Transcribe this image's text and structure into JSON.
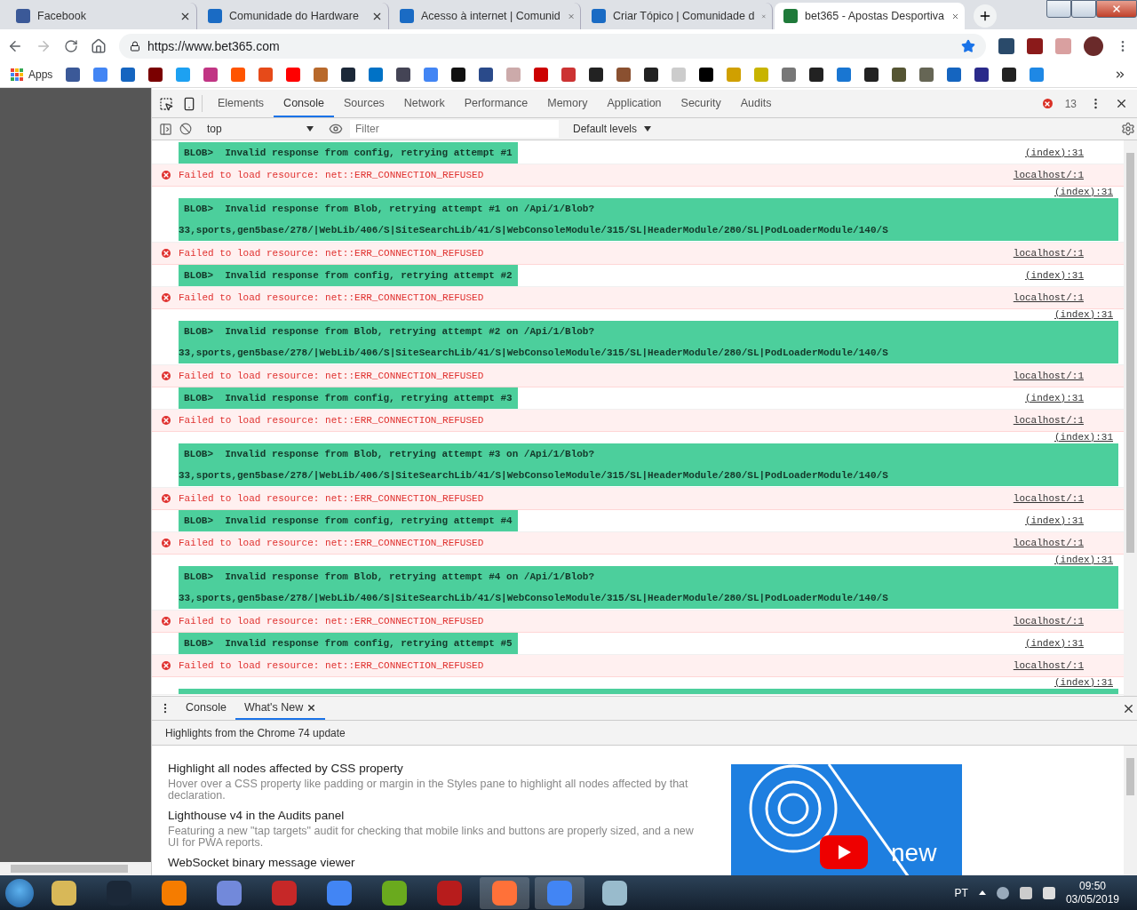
{
  "browser": {
    "tabs": [
      {
        "title": "Facebook",
        "selected": false
      },
      {
        "title": "Comunidade do Hardware",
        "selected": false
      },
      {
        "title": "Acesso à internet | Comunid",
        "selected": false
      },
      {
        "title": "Criar Tópico | Comunidade d",
        "selected": false
      },
      {
        "title": "bet365 - Apostas Desportiva",
        "selected": true
      }
    ],
    "url": "https://www.bet365.com",
    "bookmarks_label": "Apps"
  },
  "devtools": {
    "tabs": [
      {
        "label": "Elements",
        "selected": false
      },
      {
        "label": "Console",
        "selected": true
      },
      {
        "label": "Sources",
        "selected": false
      },
      {
        "label": "Network",
        "selected": false
      },
      {
        "label": "Performance",
        "selected": false
      },
      {
        "label": "Memory",
        "selected": false
      },
      {
        "label": "Application",
        "selected": false
      },
      {
        "label": "Security",
        "selected": false
      },
      {
        "label": "Audits",
        "selected": false
      }
    ],
    "error_count": "13",
    "console_toolbar": {
      "context": "top",
      "filter_placeholder": "Filter",
      "levels": "Default levels"
    },
    "messages": [
      {
        "kind": "blob",
        "lines": [
          "BLOB>  Invalid response from config, retrying attempt #1"
        ],
        "source": "(index):31"
      },
      {
        "kind": "error",
        "lines": [
          "Failed to load resource: net::ERR_CONNECTION_REFUSED"
        ],
        "source": "localhost/:1"
      },
      {
        "kind": "blob_long",
        "lines": [
          "BLOB>  Invalid response from Blob, retrying attempt #1 on /Api/1/Blob?",
          "33,sports,gen5base/278/|WebLib/406/S|SiteSearchLib/41/S|WebConsoleModule/315/SL|HeaderModule/280/SL|PodLoaderModule/140/S"
        ],
        "source": "(index):31"
      },
      {
        "kind": "error",
        "lines": [
          "Failed to load resource: net::ERR_CONNECTION_REFUSED"
        ],
        "source": "localhost/:1"
      },
      {
        "kind": "blob",
        "lines": [
          "BLOB>  Invalid response from config, retrying attempt #2"
        ],
        "source": "(index):31"
      },
      {
        "kind": "error",
        "lines": [
          "Failed to load resource: net::ERR_CONNECTION_REFUSED"
        ],
        "source": "localhost/:1"
      },
      {
        "kind": "blob_long",
        "lines": [
          "BLOB>  Invalid response from Blob, retrying attempt #2 on /Api/1/Blob?",
          "33,sports,gen5base/278/|WebLib/406/S|SiteSearchLib/41/S|WebConsoleModule/315/SL|HeaderModule/280/SL|PodLoaderModule/140/S"
        ],
        "source": "(index):31"
      },
      {
        "kind": "error",
        "lines": [
          "Failed to load resource: net::ERR_CONNECTION_REFUSED"
        ],
        "source": "localhost/:1"
      },
      {
        "kind": "blob",
        "lines": [
          "BLOB>  Invalid response from config, retrying attempt #3"
        ],
        "source": "(index):31"
      },
      {
        "kind": "error",
        "lines": [
          "Failed to load resource: net::ERR_CONNECTION_REFUSED"
        ],
        "source": "localhost/:1"
      },
      {
        "kind": "blob_long",
        "lines": [
          "BLOB>  Invalid response from Blob, retrying attempt #3 on /Api/1/Blob?",
          "33,sports,gen5base/278/|WebLib/406/S|SiteSearchLib/41/S|WebConsoleModule/315/SL|HeaderModule/280/SL|PodLoaderModule/140/S"
        ],
        "source": "(index):31"
      },
      {
        "kind": "error",
        "lines": [
          "Failed to load resource: net::ERR_CONNECTION_REFUSED"
        ],
        "source": "localhost/:1"
      },
      {
        "kind": "blob",
        "lines": [
          "BLOB>  Invalid response from config, retrying attempt #4"
        ],
        "source": "(index):31"
      },
      {
        "kind": "error",
        "lines": [
          "Failed to load resource: net::ERR_CONNECTION_REFUSED"
        ],
        "source": "localhost/:1"
      },
      {
        "kind": "blob_long",
        "lines": [
          "BLOB>  Invalid response from Blob, retrying attempt #4 on /Api/1/Blob?",
          "33,sports,gen5base/278/|WebLib/406/S|SiteSearchLib/41/S|WebConsoleModule/315/SL|HeaderModule/280/SL|PodLoaderModule/140/S"
        ],
        "source": "(index):31"
      },
      {
        "kind": "error",
        "lines": [
          "Failed to load resource: net::ERR_CONNECTION_REFUSED"
        ],
        "source": "localhost/:1"
      },
      {
        "kind": "blob",
        "lines": [
          "BLOB>  Invalid response from config, retrying attempt #5"
        ],
        "source": "(index):31"
      },
      {
        "kind": "error",
        "lines": [
          "Failed to load resource: net::ERR_CONNECTION_REFUSED"
        ],
        "source": "localhost/:1"
      },
      {
        "kind": "blob_cut",
        "source": "(index):31"
      }
    ],
    "drawer": {
      "tabs": [
        {
          "label": "Console",
          "selected": false,
          "closable": false
        },
        {
          "label": "What's New",
          "selected": true,
          "closable": true
        }
      ],
      "header": "Highlights from the Chrome 74 update",
      "items": [
        {
          "title": "Highlight all nodes affected by CSS property",
          "description": "Hover over a CSS property like padding or margin in the Styles pane to highlight all nodes affected by that declaration."
        },
        {
          "title": "Lighthouse v4 in the Audits panel",
          "description": "Featuring a new \"tap targets\" audit for checking that mobile links and buttons are properly sized, and a new UI for PWA reports."
        },
        {
          "title": "WebSocket binary message viewer"
        }
      ],
      "video_caption": "new"
    }
  },
  "taskbar": {
    "language": "PT",
    "time": "09:50",
    "date": "03/05/2019"
  }
}
